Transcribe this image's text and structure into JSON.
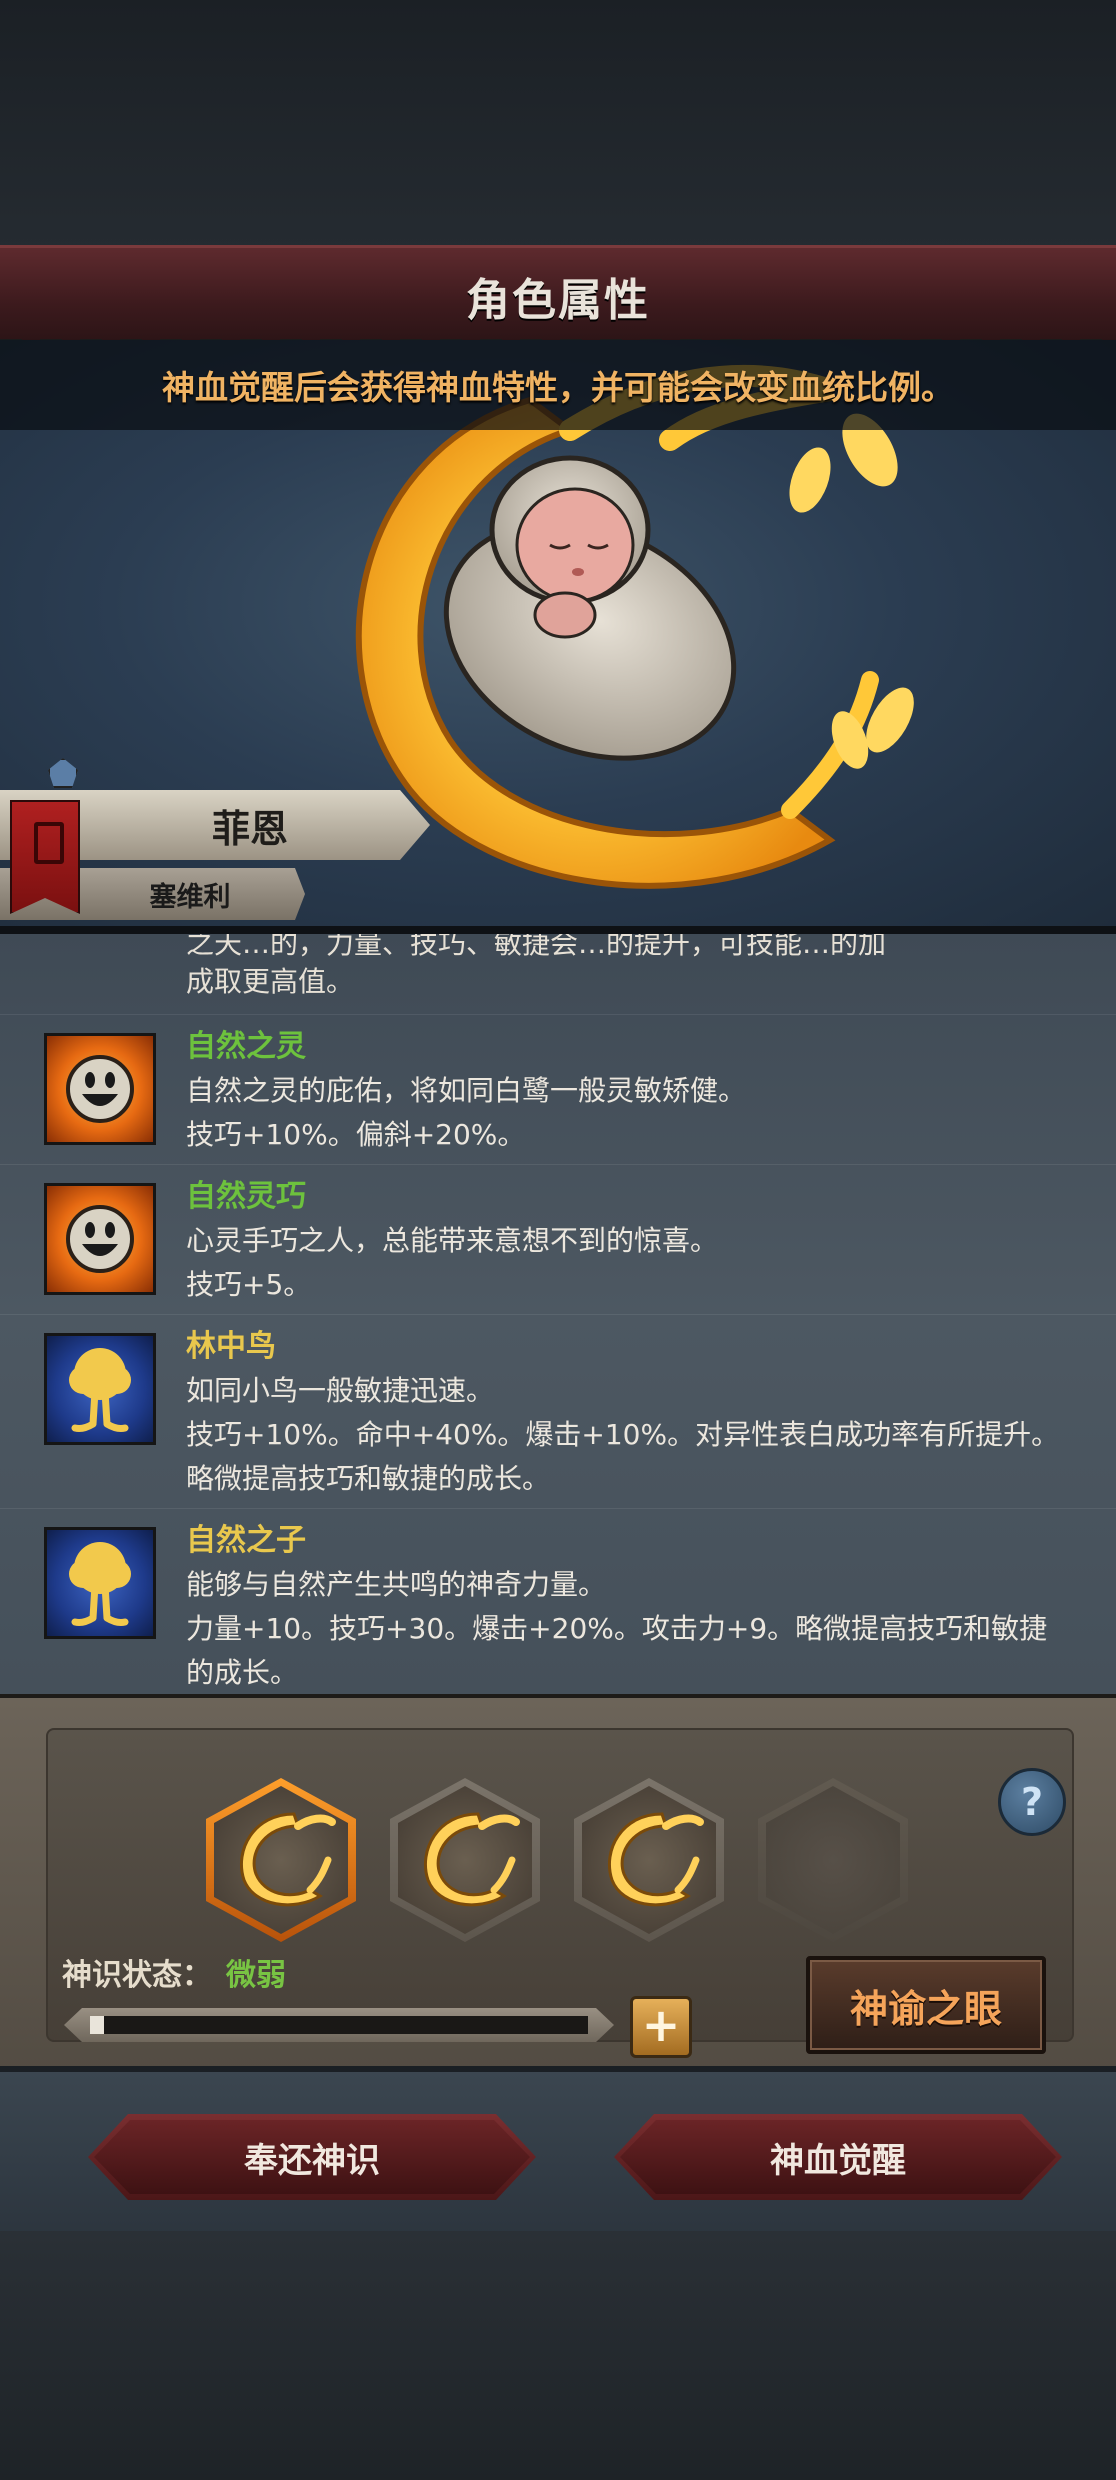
{
  "header": {
    "title": "角色属性"
  },
  "notice": {
    "text": "神血觉醒后会获得神血特性，并可能会改变血统比例。"
  },
  "character": {
    "name": "菲恩",
    "subtitle": "塞维利"
  },
  "traits": {
    "partial_line_1": "之天…的，力量、技巧、敏捷会…的提升，可技能…的加",
    "partial_line_2": "成取更高值。",
    "items": [
      {
        "name": "自然之灵",
        "color": "#6dc23d",
        "icon": "smiley-sun-icon",
        "desc": [
          "自然之灵的庇佑，将如同白鹭一般灵敏矫健。",
          "技巧+10%。偏斜+20%。"
        ]
      },
      {
        "name": "自然灵巧",
        "color": "#6dc23d",
        "icon": "smiley-sun-icon",
        "desc": [
          "心灵手巧之人，总能带来意想不到的惊喜。",
          "技巧+5。"
        ]
      },
      {
        "name": "林中鸟",
        "color": "#e9c84d",
        "icon": "golden-tree-icon",
        "desc": [
          "如同小鸟一般敏捷迅速。",
          "技巧+10%。命中+40%。爆击+10%。对异性表白成功率有所提升。",
          "略微提高技巧和敏捷的成长。"
        ]
      },
      {
        "name": "自然之子",
        "color": "#e9c84d",
        "icon": "golden-tree-icon",
        "desc": [
          "能够与自然产生共鸣的神奇力量。",
          "力量+10。技巧+30。爆击+20%。攻击力+9。略微提高技巧和敏捷",
          "的成长。"
        ]
      }
    ]
  },
  "panel": {
    "slots": [
      "active",
      "filled",
      "filled",
      "empty"
    ],
    "state_label": "神识状态：",
    "state_value": "微弱",
    "progress": 0.02,
    "plus_label": "+",
    "help_label": "?",
    "oracle_button": "神谕之眼"
  },
  "footer": {
    "return_button": "奉还神识",
    "awaken_button": "神血觉醒"
  }
}
